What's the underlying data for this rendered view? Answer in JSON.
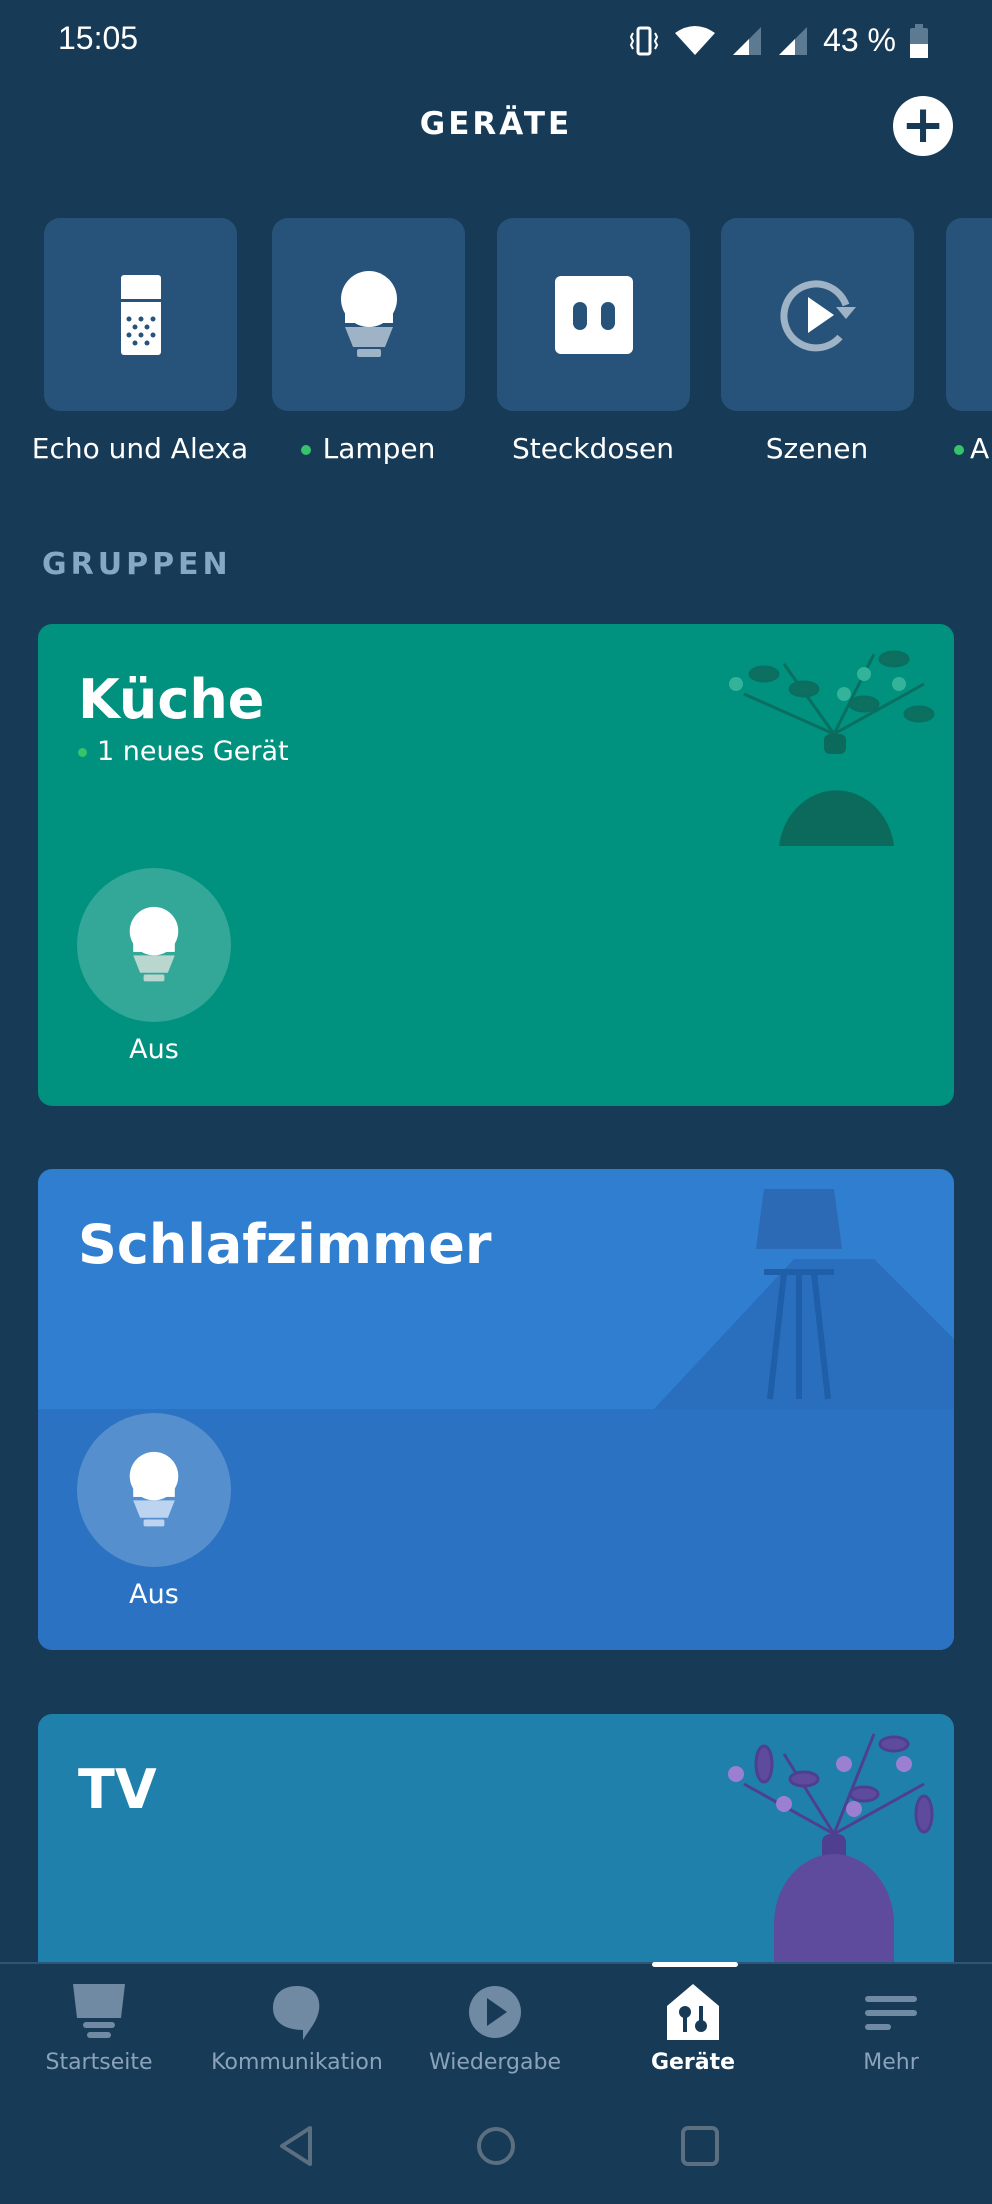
{
  "status_bar": {
    "time": "15:05",
    "battery": "43 %",
    "icons": [
      "vibrate-icon",
      "wifi-icon",
      "signal-icon",
      "signal-icon",
      "battery-icon"
    ]
  },
  "header": {
    "title": "GERÄTE",
    "add_icon": "plus-icon"
  },
  "categories": [
    {
      "label": "Echo und Alexa",
      "icon": "echo-speaker-icon",
      "new": false
    },
    {
      "label": "Lampen",
      "icon": "bulb-icon",
      "new": true
    },
    {
      "label": "Steckdosen",
      "icon": "plug-icon",
      "new": false
    },
    {
      "label": "Szenen",
      "icon": "scene-play-icon",
      "new": false
    },
    {
      "label": "A",
      "icon": "",
      "new": true
    }
  ],
  "groups_heading": "GRUPPEN",
  "groups": [
    {
      "name": "Küche",
      "subtitle": "1 neues Gerät",
      "device_state": "Aus",
      "color": "#00917f"
    },
    {
      "name": "Schlafzimmer",
      "device_state": "Aus",
      "color": "#2f7ed0"
    },
    {
      "name": "TV",
      "color": "#1f80ab"
    }
  ],
  "nav": [
    {
      "label": "Startseite",
      "icon": "home-echo-icon"
    },
    {
      "label": "Kommunikation",
      "icon": "chat-bubble-icon"
    },
    {
      "label": "Wiedergabe",
      "icon": "play-icon"
    },
    {
      "label": "Geräte",
      "icon": "devices-house-icon",
      "active": true
    },
    {
      "label": "Mehr",
      "icon": "menu-icon"
    }
  ]
}
